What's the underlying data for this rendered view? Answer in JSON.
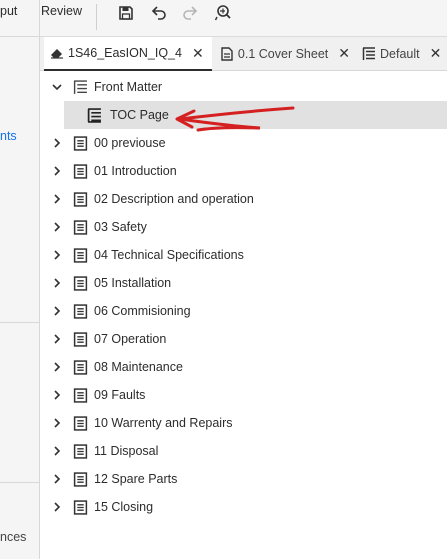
{
  "left_panel": {
    "cut_label_top": "put",
    "cut_label_mid": "nts",
    "cut_label_bottom": "nces"
  },
  "menu": {
    "review_label": "Review"
  },
  "toolbar": {
    "icons": [
      "save-icon",
      "undo-icon",
      "redo-icon",
      "find-icon"
    ]
  },
  "tabs": [
    {
      "label": "1S46_EasION_IQ_4",
      "icon": "eraser-icon",
      "active": true,
      "close": "✕"
    },
    {
      "label": "0.1 Cover Sheet",
      "icon": "document-icon",
      "active": false,
      "close": "✕"
    },
    {
      "label": "Default",
      "icon": "list-icon",
      "active": false,
      "close": "✕"
    }
  ],
  "tree": {
    "front_matter": {
      "label": "Front Matter",
      "expanded": true
    },
    "toc_page": {
      "label": "TOC Page",
      "selected": true
    },
    "chapters": [
      "00 previouse",
      "01 Introduction",
      "02 Description and operation",
      "03 Safety",
      "04 Technical Specifications",
      "05 Installation",
      "06 Commisioning",
      "07 Operation",
      "08 Maintenance",
      "09 Faults",
      "10 Warrenty and Repairs",
      "11 Disposal",
      "12 Spare Parts",
      "15 Closing"
    ]
  },
  "colors": {
    "annotation_arrow": "#d42020",
    "selected_row": "#e1e1e1",
    "link_blue": "#1473e6"
  }
}
